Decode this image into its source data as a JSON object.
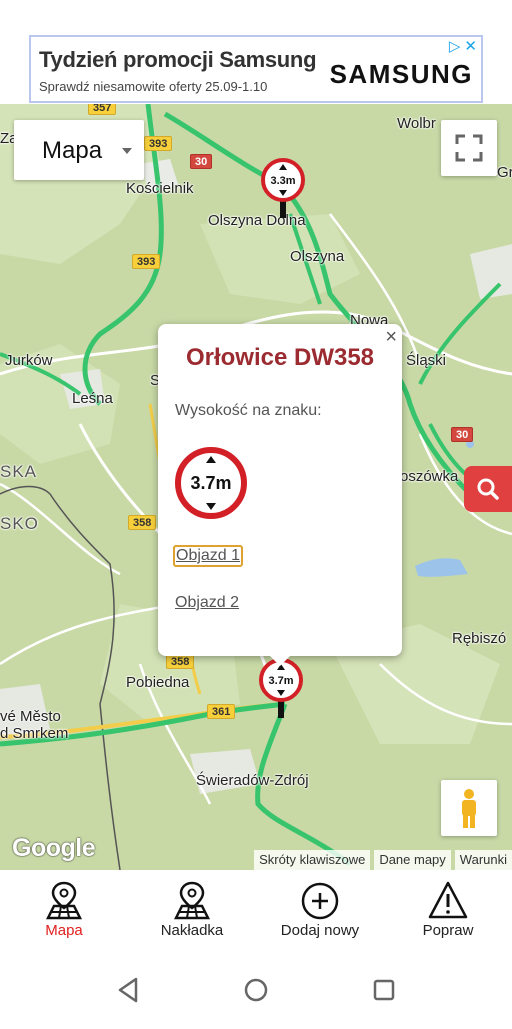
{
  "ad": {
    "title": "Tydzień promocji Samsung",
    "subtitle": "Sprawdź niesamowite oferty 25.09-1.10",
    "brand": "SAMSUNG",
    "adchoices_icon": "adchoices-icon",
    "close_icon": "close-icon"
  },
  "map": {
    "type_label": "Mapa",
    "place_labels": [
      "Kościelnik",
      "Olszyna Dolna",
      "Olszyna",
      "Nowa",
      "Śląski",
      "Jurków",
      "Leśna",
      "S",
      "SKA",
      "SKO",
      "oszówka",
      "Rębiszó",
      "Pobiedna",
      "vé Město",
      "d Smrkem",
      "Świeradów-Zdrój",
      "Wolbr",
      "Gr",
      "Za"
    ],
    "road_numbers": {
      "r357": "357",
      "r393a": "393",
      "r393b": "393",
      "r30a": "30",
      "r30b": "30",
      "r358a": "358",
      "r358b": "358",
      "r361": "361"
    },
    "marker_top_sign": "3.3m",
    "marker_bottom_sign": "3.7m",
    "google": "Google",
    "attributions": [
      "Skróty klawiszowe",
      "Dane mapy",
      "Warunki"
    ],
    "colors": {
      "accent_red": "#e04040",
      "title_red": "#9b2b30",
      "road_green": "#37c46c"
    }
  },
  "popup": {
    "title": "Orłowice DW358",
    "close": "×",
    "label": "Wysokość na znaku:",
    "sign_value": "3.7m",
    "detour1": "Objazd 1",
    "detour2": "Objazd 2"
  },
  "nav": {
    "items": [
      {
        "label": "Mapa",
        "icon": "map-pin-icon",
        "active": true
      },
      {
        "label": "Nakładka",
        "icon": "map-pin-icon",
        "active": false
      },
      {
        "label": "Dodaj nowy",
        "icon": "plus-circle-icon",
        "active": false
      },
      {
        "label": "Popraw",
        "icon": "warning-icon",
        "active": false
      }
    ]
  }
}
